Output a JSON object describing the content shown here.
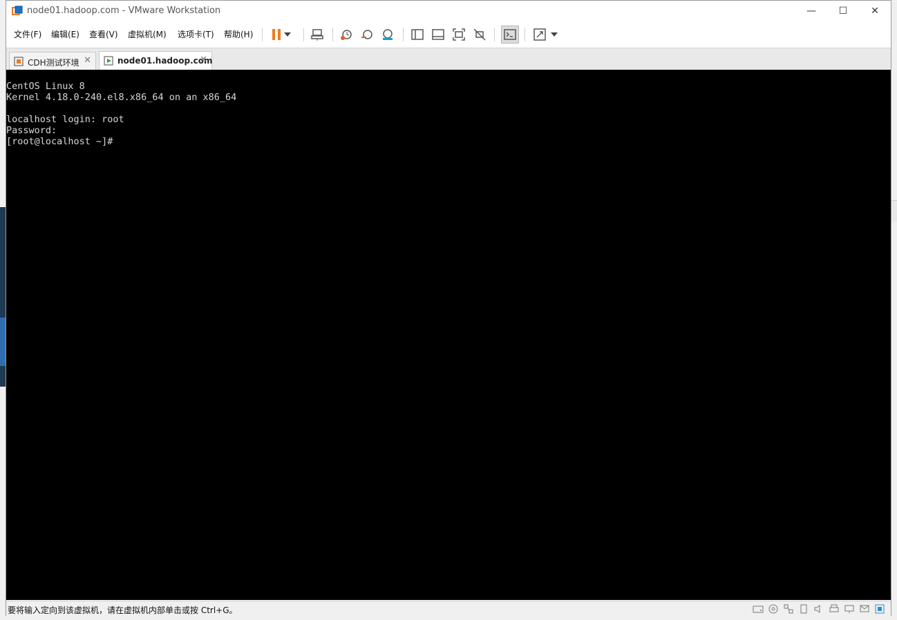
{
  "window": {
    "title": "node01.hadoop.com - VMware Workstation",
    "controls": {
      "minimize": "—",
      "maximize": "☐",
      "close": "✕"
    }
  },
  "menu": {
    "file": "文件(F)",
    "edit": "编辑(E)",
    "view": "查看(V)",
    "vm": "虚拟机(M)",
    "tabs": "选项卡(T)",
    "help": "帮助(H)"
  },
  "toolbar_icons": [
    "pause-icon",
    "dropdown-icon",
    "send-ctrl-alt-del-icon",
    "snapshot-icon",
    "revert-snapshot-icon",
    "snapshot-manager-icon",
    "sidebar-icon",
    "thumbnail-bar-icon",
    "fullscreen-icon",
    "unity-icon",
    "console-view-icon",
    "stretch-icon",
    "dropdown-icon"
  ],
  "tabs": [
    {
      "label": "CDH测试环境",
      "close": "✕",
      "active": false
    },
    {
      "label": "node01.hadoop.com",
      "close": "✕",
      "active": true
    }
  ],
  "console": {
    "lines": [
      "CentOS Linux 8",
      "Kernel 4.18.0-240.el8.x86_64 on an x86_64",
      "",
      "localhost login: root",
      "Password:",
      "[root@localhost ~]#"
    ]
  },
  "status": {
    "message": "要将输入定向到该虚拟机，请在虚拟机内部单击或按 Ctrl+G。",
    "icons": [
      "hard-disk-icon",
      "cd-rom-icon",
      "network-icon",
      "usb-icon",
      "sound-icon",
      "printer-icon",
      "display-icon",
      "message-icon",
      "device-icon"
    ]
  },
  "colors": {
    "accent_orange": "#f07b1f",
    "console_bg": "#000000",
    "console_fg": "#d8d8d8"
  }
}
